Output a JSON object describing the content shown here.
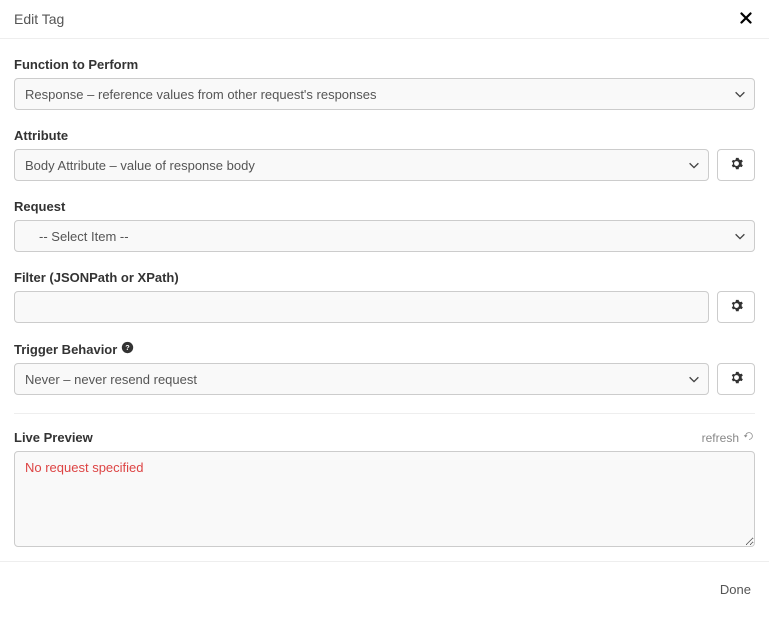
{
  "header": {
    "title": "Edit Tag"
  },
  "function": {
    "label": "Function to Perform",
    "selected": "Response – reference values from other request's responses"
  },
  "attribute": {
    "label": "Attribute",
    "selected": "Body Attribute – value of response body"
  },
  "request": {
    "label": "Request",
    "selected": "-- Select Item --"
  },
  "filter": {
    "label": "Filter (JSONPath or XPath)",
    "value": ""
  },
  "trigger": {
    "label": "Trigger Behavior",
    "selected": "Never – never resend request"
  },
  "preview": {
    "label": "Live Preview",
    "refresh_label": "refresh",
    "message": "No request specified"
  },
  "footer": {
    "done": "Done"
  }
}
